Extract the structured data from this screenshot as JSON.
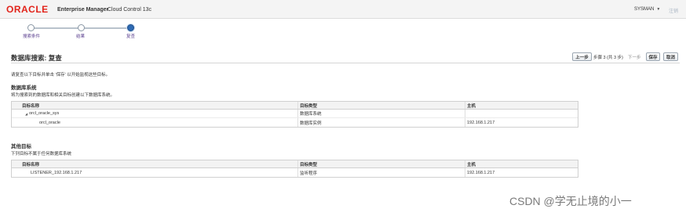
{
  "header": {
    "brand": "ORACLE",
    "product": "Enterprise Manager",
    "edition": "Cloud Control 13c",
    "user": "SYSMAN",
    "user_menu_icon": "chevron-down-icon",
    "right_link": "注销"
  },
  "train": {
    "steps": [
      {
        "label": "搜索条件",
        "state": "visited"
      },
      {
        "label": "结果",
        "state": "visited"
      },
      {
        "label": "复查",
        "state": "current"
      }
    ]
  },
  "page": {
    "title": "数据库搜索: 复查",
    "back_label": "上一步",
    "step_text": "步骤 3 (共 3 步)",
    "next_label": "下一步",
    "save_label": "保存",
    "cancel_label": "取消",
    "info": "请复查以下目标并单击 '保存' 以开始监视这些目标。"
  },
  "db_systems": {
    "heading": "数据库系统",
    "desc": "将为搜索到的数据库和相关目标创建以下数据库系统。",
    "columns": [
      "目标名称",
      "目标类型",
      "主机"
    ],
    "rows": [
      {
        "name": "orcl_oracle_sys",
        "type": "数据库系统",
        "host": "",
        "expanded": true
      },
      {
        "name": "orcl_oracle",
        "type": "数据库实例",
        "host": "192.168.1.217"
      }
    ]
  },
  "other_targets": {
    "heading": "其他目标",
    "desc": "下列目标不属于任何数据库系统",
    "columns": [
      "目标名称",
      "目标类型",
      "主机"
    ],
    "rows": [
      {
        "name": "LISTENER_192.168.1.217",
        "type": "监听程序",
        "host": "192.168.1.217"
      }
    ]
  },
  "watermark": "CSDN @学无止境的小一",
  "colors": {
    "brand_red": "#e2231a",
    "train_current": "#2e6ab3",
    "train_label": "#5a3e8e"
  }
}
